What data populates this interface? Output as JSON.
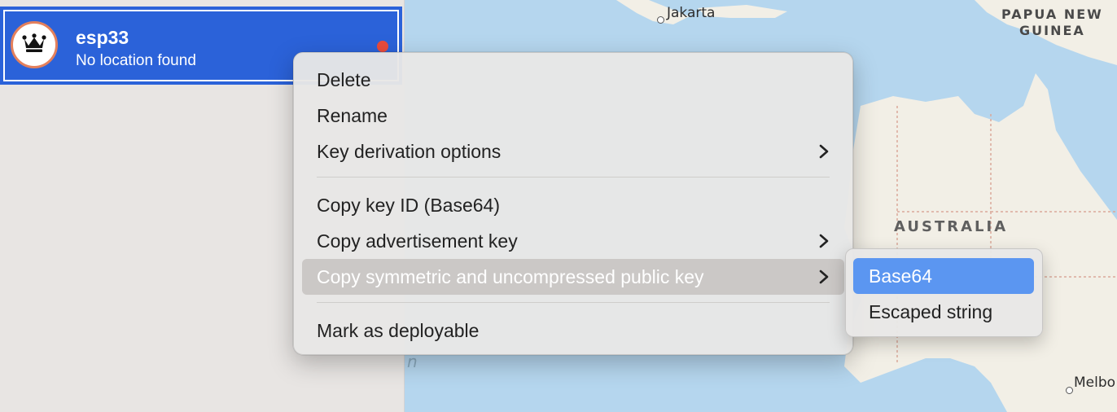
{
  "sidebar": {
    "device": {
      "name": "esp33",
      "status": "No location found",
      "avatar_icon": "crown-icon",
      "status_dot_color": "#e94b3c"
    }
  },
  "map": {
    "labels": {
      "jakarta": "Jakarta",
      "papua_line1": "PAPUA NEW",
      "papua_line2": "GUINEA",
      "australia": "AUSTRALIA",
      "melbourne": "Melbo",
      "faint_glyph": "n"
    }
  },
  "context_menu": {
    "items": [
      {
        "label": "Delete",
        "has_submenu": false
      },
      {
        "label": "Rename",
        "has_submenu": false
      },
      {
        "label": "Key derivation options",
        "has_submenu": true
      },
      {
        "label": "Copy key ID (Base64)",
        "has_submenu": false
      },
      {
        "label": "Copy advertisement key",
        "has_submenu": true
      },
      {
        "label": "Copy symmetric and uncompressed public key",
        "has_submenu": true,
        "highlighted": true
      },
      {
        "label": "Mark as deployable",
        "has_submenu": false
      }
    ]
  },
  "submenu": {
    "items": [
      {
        "label": "Base64",
        "selected": true
      },
      {
        "label": "Escaped string",
        "selected": false
      }
    ]
  },
  "colors": {
    "selection_blue": "#2b62d9",
    "submenu_selection": "#5b96f1",
    "map_water": "#b5d6ee",
    "map_land": "#f2efe6"
  }
}
